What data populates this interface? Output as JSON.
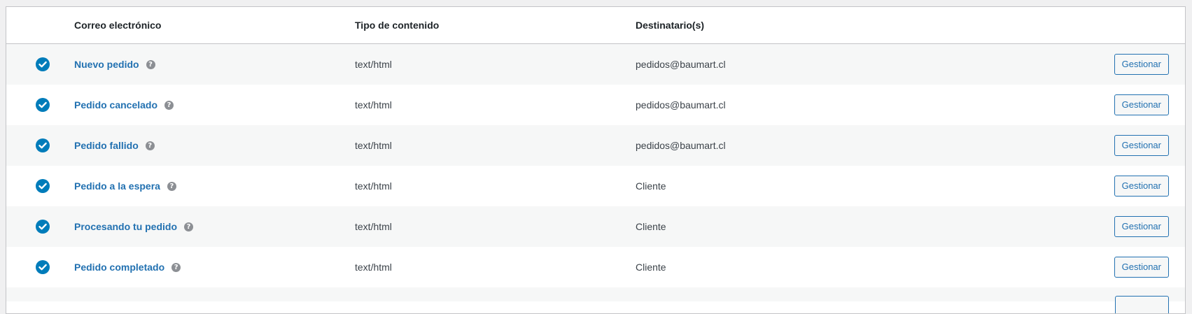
{
  "headers": {
    "email": "Correo electrónico",
    "content_type": "Tipo de contenido",
    "recipients": "Destinatario(s)"
  },
  "help_glyph": "?",
  "rows": [
    {
      "name": "Nuevo pedido",
      "type": "text/html",
      "recipient": "pedidos@baumart.cl",
      "action": "Gestionar"
    },
    {
      "name": "Pedido cancelado",
      "type": "text/html",
      "recipient": "pedidos@baumart.cl",
      "action": "Gestionar"
    },
    {
      "name": "Pedido fallido",
      "type": "text/html",
      "recipient": "pedidos@baumart.cl",
      "action": "Gestionar"
    },
    {
      "name": "Pedido a la espera",
      "type": "text/html",
      "recipient": "Cliente",
      "action": "Gestionar"
    },
    {
      "name": "Procesando tu pedido",
      "type": "text/html",
      "recipient": "Cliente",
      "action": "Gestionar"
    },
    {
      "name": "Pedido completado",
      "type": "text/html",
      "recipient": "Cliente",
      "action": "Gestionar"
    }
  ],
  "colors": {
    "accent": "#2271b1",
    "check": "#007cba"
  }
}
